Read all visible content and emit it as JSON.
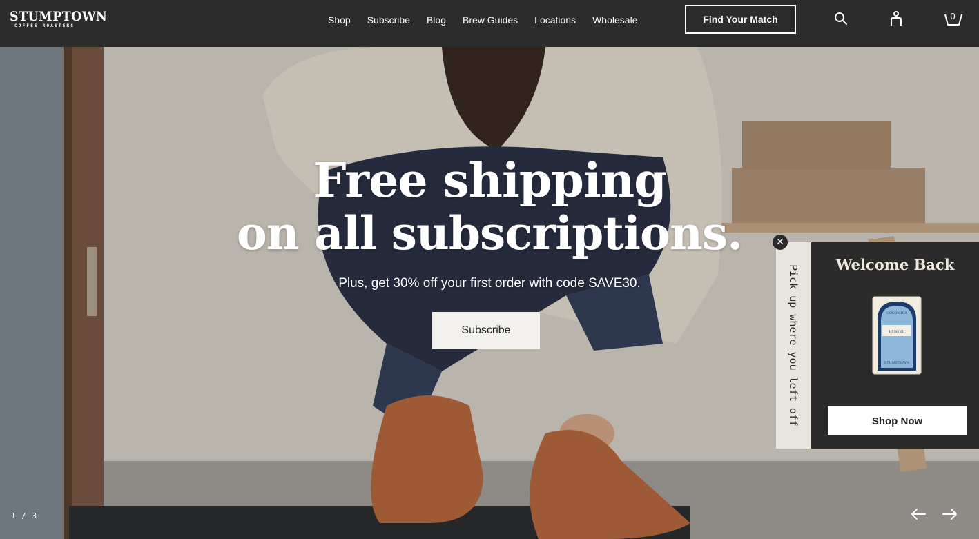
{
  "header": {
    "logo_main": "STUMPTOWN",
    "logo_sub": "COFFEE ROASTERS",
    "nav": [
      "Shop",
      "Subscribe",
      "Blog",
      "Brew Guides",
      "Locations",
      "Wholesale"
    ],
    "cta_label": "Find Your Match",
    "icons": [
      "search-icon",
      "account-icon",
      "cart-icon"
    ],
    "cart_count": "0"
  },
  "hero": {
    "title_line1": "Free shipping",
    "title_line2": "on all subscriptions.",
    "subtitle": "Plus, get 30% off your first order with code SAVE30.",
    "button_label": "Subscribe",
    "slide_counter": "1 / 3",
    "arrows": [
      "arrow-left-icon",
      "arrow-right-icon"
    ]
  },
  "popup": {
    "tab_text": "Pick up where you left off",
    "close_icon": "close-icon",
    "title": "Welcome Back",
    "button_label": "Shop Now",
    "bag_label_top": "COLOMBIA",
    "bag_label_name": "HUAYKU",
    "bag_brand": "STUMPTOWN"
  },
  "colors": {
    "header_bg": "#2c2c2c",
    "popup_bg": "#2b2b2b",
    "popup_tab_bg": "#e8e4de",
    "hero_button_bg": "#f3f1ee",
    "bag_blue": "#8fb7d9"
  }
}
